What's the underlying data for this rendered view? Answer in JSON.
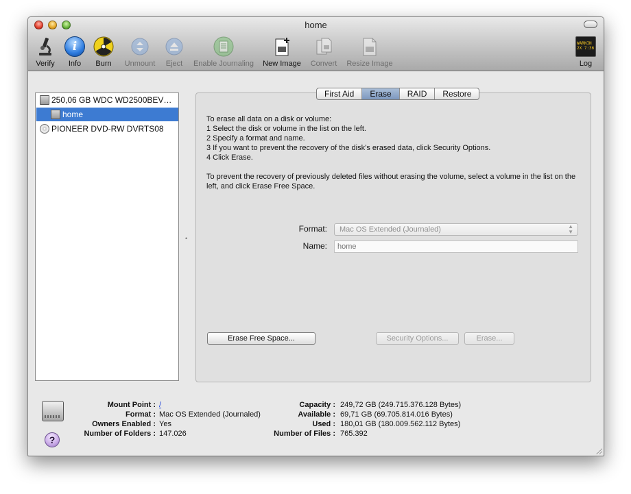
{
  "window": {
    "title": "home"
  },
  "toolbar": {
    "items": [
      {
        "label": "Verify",
        "icon": "microscope-icon",
        "enabled": true
      },
      {
        "label": "Info",
        "icon": "info-icon",
        "enabled": true
      },
      {
        "label": "Burn",
        "icon": "burn-icon",
        "enabled": true
      },
      {
        "label": "Unmount",
        "icon": "unmount-icon",
        "enabled": false
      },
      {
        "label": "Eject",
        "icon": "eject-icon",
        "enabled": false
      },
      {
        "label": "Enable Journaling",
        "icon": "journal-icon",
        "enabled": false
      },
      {
        "label": "New Image",
        "icon": "new-image-icon",
        "enabled": true
      },
      {
        "label": "Convert",
        "icon": "convert-icon",
        "enabled": false
      },
      {
        "label": "Resize Image",
        "icon": "resize-image-icon",
        "enabled": false
      },
      {
        "label": "Log",
        "icon": "log-icon",
        "enabled": true
      }
    ],
    "log_badge": "WARNIN\n2X 7:36"
  },
  "sidebar": {
    "items": [
      {
        "label": "250,06 GB WDC WD2500BEV…",
        "icon": "hard-disk-icon",
        "level": 0,
        "selected": false
      },
      {
        "label": "home",
        "icon": "volume-icon",
        "level": 1,
        "selected": true
      },
      {
        "label": "PIONEER DVD-RW DVRTS08",
        "icon": "optical-drive-icon",
        "level": 0,
        "selected": false
      }
    ]
  },
  "tabs": [
    {
      "label": "First Aid",
      "active": false
    },
    {
      "label": "Erase",
      "active": true
    },
    {
      "label": "RAID",
      "active": false
    },
    {
      "label": "Restore",
      "active": false
    }
  ],
  "erase": {
    "instructions": [
      "To erase all data on a disk or volume:",
      "1 Select the disk or volume in the list on the left.",
      "2 Specify a format and name.",
      "3 If you want to prevent the recovery of the disk’s erased data, click Security Options.",
      "4 Click Erase."
    ],
    "free_space_note": "To prevent the recovery of previously deleted files without erasing the volume, select a volume in the list on the left, and click Erase Free Space.",
    "format_label": "Format:",
    "format_value": "Mac OS Extended (Journaled)",
    "name_label": "Name:",
    "name_placeholder": "home",
    "erase_free_space_button": "Erase Free Space...",
    "security_options_button": "Security Options...",
    "erase_button": "Erase..."
  },
  "info": {
    "mount_point_key": "Mount Point :",
    "mount_point_val": "/",
    "format_key": "Format :",
    "format_val": "Mac OS Extended (Journaled)",
    "owners_key": "Owners Enabled :",
    "owners_val": "Yes",
    "folders_key": "Number of Folders :",
    "folders_val": "147.026",
    "capacity_key": "Capacity :",
    "capacity_val": "249,72 GB (249.715.376.128 Bytes)",
    "available_key": "Available :",
    "available_val": "69,71 GB (69.705.814.016 Bytes)",
    "used_key": "Used :",
    "used_val": "180,01 GB (180.009.562.112 Bytes)",
    "files_key": "Number of Files :",
    "files_val": "765.392"
  },
  "help": {
    "glyph": "?"
  },
  "colors": {
    "selection": "#3d7bd2",
    "link": "#1a3fd8"
  }
}
